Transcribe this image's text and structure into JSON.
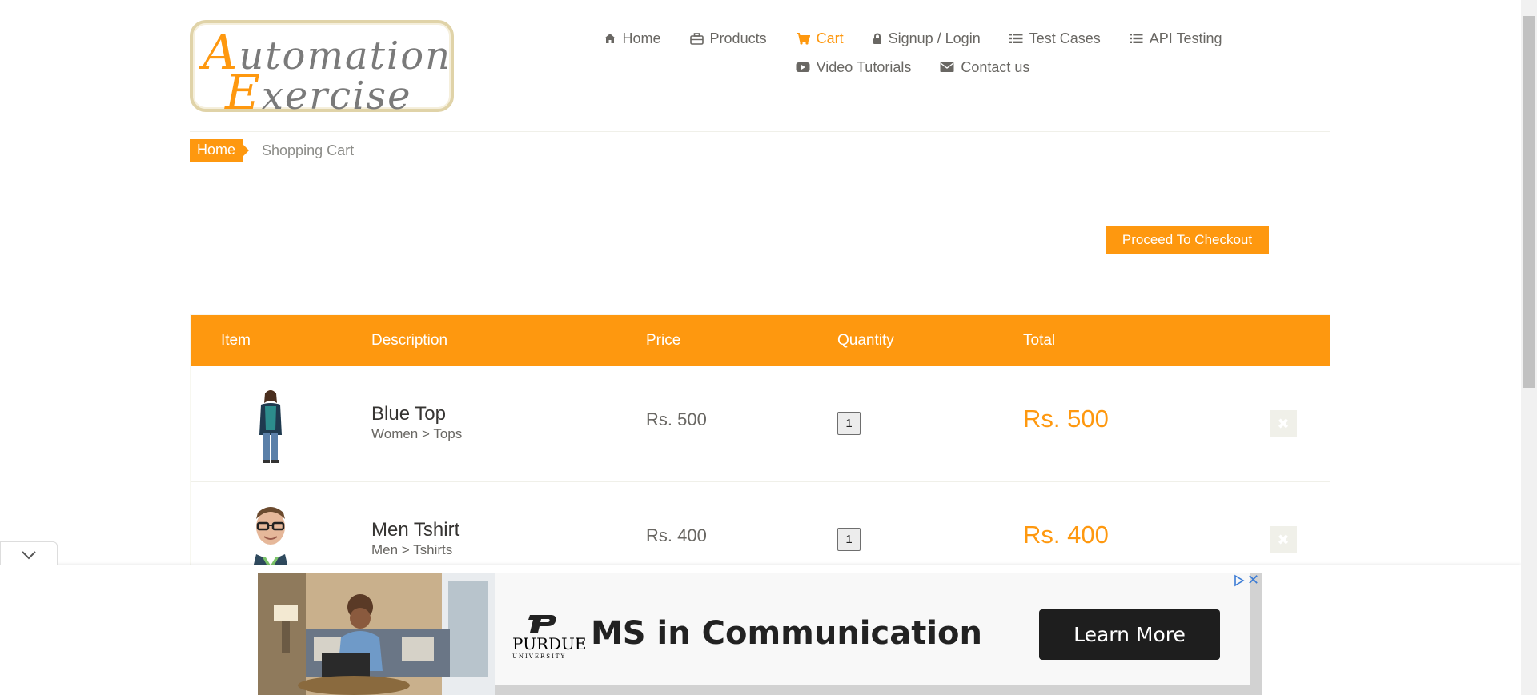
{
  "logo": {
    "line1_cap": "A",
    "line1_rest": "utomation",
    "line2_cap": "E",
    "line2_rest": "xercise"
  },
  "nav": {
    "items": [
      {
        "label": "Home",
        "icon": "home-icon"
      },
      {
        "label": "Products",
        "icon": "briefcase-icon"
      },
      {
        "label": "Cart",
        "icon": "cart-icon",
        "active": true
      },
      {
        "label": "Signup / Login",
        "icon": "lock-icon"
      },
      {
        "label": "Test Cases",
        "icon": "list-icon"
      },
      {
        "label": "API Testing",
        "icon": "list-icon"
      },
      {
        "label": "Video Tutorials",
        "icon": "youtube-icon"
      },
      {
        "label": "Contact us",
        "icon": "envelope-icon"
      }
    ]
  },
  "breadcrumb": {
    "home": "Home",
    "current": "Shopping Cart"
  },
  "checkout_label": "Proceed To Checkout",
  "cart": {
    "headers": {
      "item": "Item",
      "description": "Description",
      "price": "Price",
      "quantity": "Quantity",
      "total": "Total"
    },
    "rows": [
      {
        "name": "Blue Top",
        "category": "Women > Tops",
        "price": "Rs. 500",
        "quantity": "1",
        "total": "Rs. 500"
      },
      {
        "name": "Men Tshirt",
        "category": "Men > Tshirts",
        "price": "Rs. 400",
        "quantity": "1",
        "total": "Rs. 400"
      }
    ],
    "delete_icon": "close-icon"
  },
  "ad": {
    "brand_word": "PURDUE",
    "brand_sub": "UNIVERSITY",
    "headline": "MS in Communication",
    "cta": "Learn More"
  },
  "colors": {
    "accent": "#fe980f",
    "text": "#696763",
    "dark": "#363432",
    "ad_button": "#1e1e1e"
  }
}
